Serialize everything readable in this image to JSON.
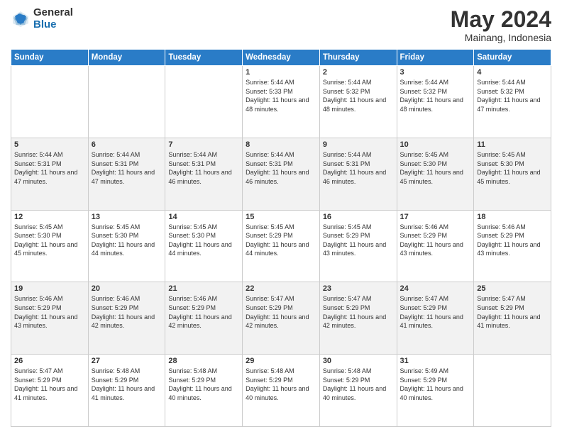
{
  "header": {
    "logo_general": "General",
    "logo_blue": "Blue",
    "month_title": "May 2024",
    "location": "Mainang, Indonesia"
  },
  "weekdays": [
    "Sunday",
    "Monday",
    "Tuesday",
    "Wednesday",
    "Thursday",
    "Friday",
    "Saturday"
  ],
  "weeks": [
    [
      {
        "day": "",
        "sunrise": "",
        "sunset": "",
        "daylight": ""
      },
      {
        "day": "",
        "sunrise": "",
        "sunset": "",
        "daylight": ""
      },
      {
        "day": "",
        "sunrise": "",
        "sunset": "",
        "daylight": ""
      },
      {
        "day": "1",
        "sunrise": "Sunrise: 5:44 AM",
        "sunset": "Sunset: 5:33 PM",
        "daylight": "Daylight: 11 hours and 48 minutes."
      },
      {
        "day": "2",
        "sunrise": "Sunrise: 5:44 AM",
        "sunset": "Sunset: 5:32 PM",
        "daylight": "Daylight: 11 hours and 48 minutes."
      },
      {
        "day": "3",
        "sunrise": "Sunrise: 5:44 AM",
        "sunset": "Sunset: 5:32 PM",
        "daylight": "Daylight: 11 hours and 48 minutes."
      },
      {
        "day": "4",
        "sunrise": "Sunrise: 5:44 AM",
        "sunset": "Sunset: 5:32 PM",
        "daylight": "Daylight: 11 hours and 47 minutes."
      }
    ],
    [
      {
        "day": "5",
        "sunrise": "Sunrise: 5:44 AM",
        "sunset": "Sunset: 5:31 PM",
        "daylight": "Daylight: 11 hours and 47 minutes."
      },
      {
        "day": "6",
        "sunrise": "Sunrise: 5:44 AM",
        "sunset": "Sunset: 5:31 PM",
        "daylight": "Daylight: 11 hours and 47 minutes."
      },
      {
        "day": "7",
        "sunrise": "Sunrise: 5:44 AM",
        "sunset": "Sunset: 5:31 PM",
        "daylight": "Daylight: 11 hours and 46 minutes."
      },
      {
        "day": "8",
        "sunrise": "Sunrise: 5:44 AM",
        "sunset": "Sunset: 5:31 PM",
        "daylight": "Daylight: 11 hours and 46 minutes."
      },
      {
        "day": "9",
        "sunrise": "Sunrise: 5:44 AM",
        "sunset": "Sunset: 5:31 PM",
        "daylight": "Daylight: 11 hours and 46 minutes."
      },
      {
        "day": "10",
        "sunrise": "Sunrise: 5:45 AM",
        "sunset": "Sunset: 5:30 PM",
        "daylight": "Daylight: 11 hours and 45 minutes."
      },
      {
        "day": "11",
        "sunrise": "Sunrise: 5:45 AM",
        "sunset": "Sunset: 5:30 PM",
        "daylight": "Daylight: 11 hours and 45 minutes."
      }
    ],
    [
      {
        "day": "12",
        "sunrise": "Sunrise: 5:45 AM",
        "sunset": "Sunset: 5:30 PM",
        "daylight": "Daylight: 11 hours and 45 minutes."
      },
      {
        "day": "13",
        "sunrise": "Sunrise: 5:45 AM",
        "sunset": "Sunset: 5:30 PM",
        "daylight": "Daylight: 11 hours and 44 minutes."
      },
      {
        "day": "14",
        "sunrise": "Sunrise: 5:45 AM",
        "sunset": "Sunset: 5:30 PM",
        "daylight": "Daylight: 11 hours and 44 minutes."
      },
      {
        "day": "15",
        "sunrise": "Sunrise: 5:45 AM",
        "sunset": "Sunset: 5:29 PM",
        "daylight": "Daylight: 11 hours and 44 minutes."
      },
      {
        "day": "16",
        "sunrise": "Sunrise: 5:45 AM",
        "sunset": "Sunset: 5:29 PM",
        "daylight": "Daylight: 11 hours and 43 minutes."
      },
      {
        "day": "17",
        "sunrise": "Sunrise: 5:46 AM",
        "sunset": "Sunset: 5:29 PM",
        "daylight": "Daylight: 11 hours and 43 minutes."
      },
      {
        "day": "18",
        "sunrise": "Sunrise: 5:46 AM",
        "sunset": "Sunset: 5:29 PM",
        "daylight": "Daylight: 11 hours and 43 minutes."
      }
    ],
    [
      {
        "day": "19",
        "sunrise": "Sunrise: 5:46 AM",
        "sunset": "Sunset: 5:29 PM",
        "daylight": "Daylight: 11 hours and 43 minutes."
      },
      {
        "day": "20",
        "sunrise": "Sunrise: 5:46 AM",
        "sunset": "Sunset: 5:29 PM",
        "daylight": "Daylight: 11 hours and 42 minutes."
      },
      {
        "day": "21",
        "sunrise": "Sunrise: 5:46 AM",
        "sunset": "Sunset: 5:29 PM",
        "daylight": "Daylight: 11 hours and 42 minutes."
      },
      {
        "day": "22",
        "sunrise": "Sunrise: 5:47 AM",
        "sunset": "Sunset: 5:29 PM",
        "daylight": "Daylight: 11 hours and 42 minutes."
      },
      {
        "day": "23",
        "sunrise": "Sunrise: 5:47 AM",
        "sunset": "Sunset: 5:29 PM",
        "daylight": "Daylight: 11 hours and 42 minutes."
      },
      {
        "day": "24",
        "sunrise": "Sunrise: 5:47 AM",
        "sunset": "Sunset: 5:29 PM",
        "daylight": "Daylight: 11 hours and 41 minutes."
      },
      {
        "day": "25",
        "sunrise": "Sunrise: 5:47 AM",
        "sunset": "Sunset: 5:29 PM",
        "daylight": "Daylight: 11 hours and 41 minutes."
      }
    ],
    [
      {
        "day": "26",
        "sunrise": "Sunrise: 5:47 AM",
        "sunset": "Sunset: 5:29 PM",
        "daylight": "Daylight: 11 hours and 41 minutes."
      },
      {
        "day": "27",
        "sunrise": "Sunrise: 5:48 AM",
        "sunset": "Sunset: 5:29 PM",
        "daylight": "Daylight: 11 hours and 41 minutes."
      },
      {
        "day": "28",
        "sunrise": "Sunrise: 5:48 AM",
        "sunset": "Sunset: 5:29 PM",
        "daylight": "Daylight: 11 hours and 40 minutes."
      },
      {
        "day": "29",
        "sunrise": "Sunrise: 5:48 AM",
        "sunset": "Sunset: 5:29 PM",
        "daylight": "Daylight: 11 hours and 40 minutes."
      },
      {
        "day": "30",
        "sunrise": "Sunrise: 5:48 AM",
        "sunset": "Sunset: 5:29 PM",
        "daylight": "Daylight: 11 hours and 40 minutes."
      },
      {
        "day": "31",
        "sunrise": "Sunrise: 5:49 AM",
        "sunset": "Sunset: 5:29 PM",
        "daylight": "Daylight: 11 hours and 40 minutes."
      },
      {
        "day": "",
        "sunrise": "",
        "sunset": "",
        "daylight": ""
      }
    ]
  ]
}
